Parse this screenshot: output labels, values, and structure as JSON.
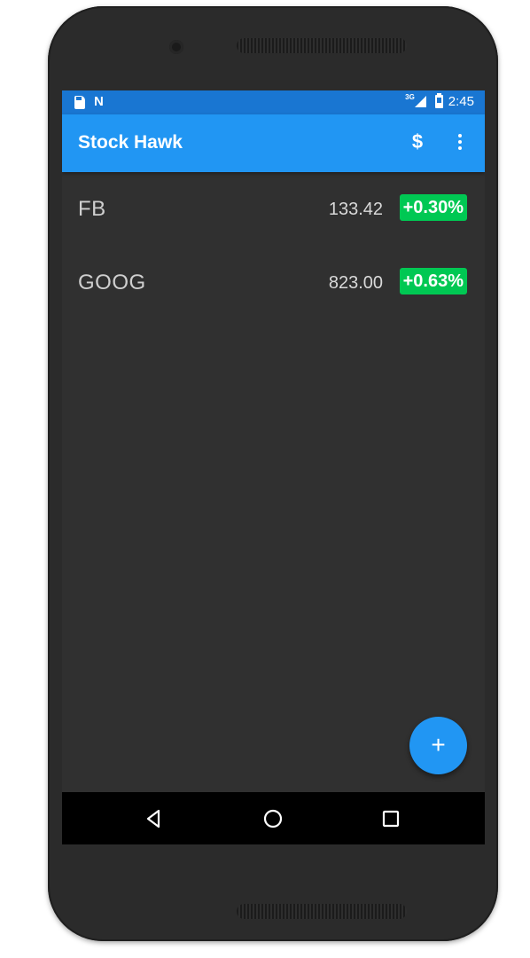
{
  "status_bar": {
    "network": "3G",
    "time": "2:45",
    "left_icons": [
      "sd-card-icon",
      "n-notification-icon"
    ],
    "right_icons": [
      "signal-icon",
      "battery-icon"
    ]
  },
  "app_bar": {
    "title": "Stock Hawk",
    "actions": [
      {
        "icon": "dollar-icon",
        "label": "$"
      },
      {
        "icon": "overflow-menu-icon"
      }
    ],
    "color": "#2196f3",
    "status_color": "#1976d2"
  },
  "stocks": [
    {
      "symbol": "FB",
      "price": "133.42",
      "change": "+0.30%"
    },
    {
      "symbol": "GOOG",
      "price": "823.00",
      "change": "+0.63%"
    }
  ],
  "change_badge_color": "#00c853",
  "fab": {
    "label": "+",
    "icon": "add-icon"
  },
  "nav_bar": {
    "buttons": [
      "back-icon",
      "home-icon",
      "recent-apps-icon"
    ]
  }
}
